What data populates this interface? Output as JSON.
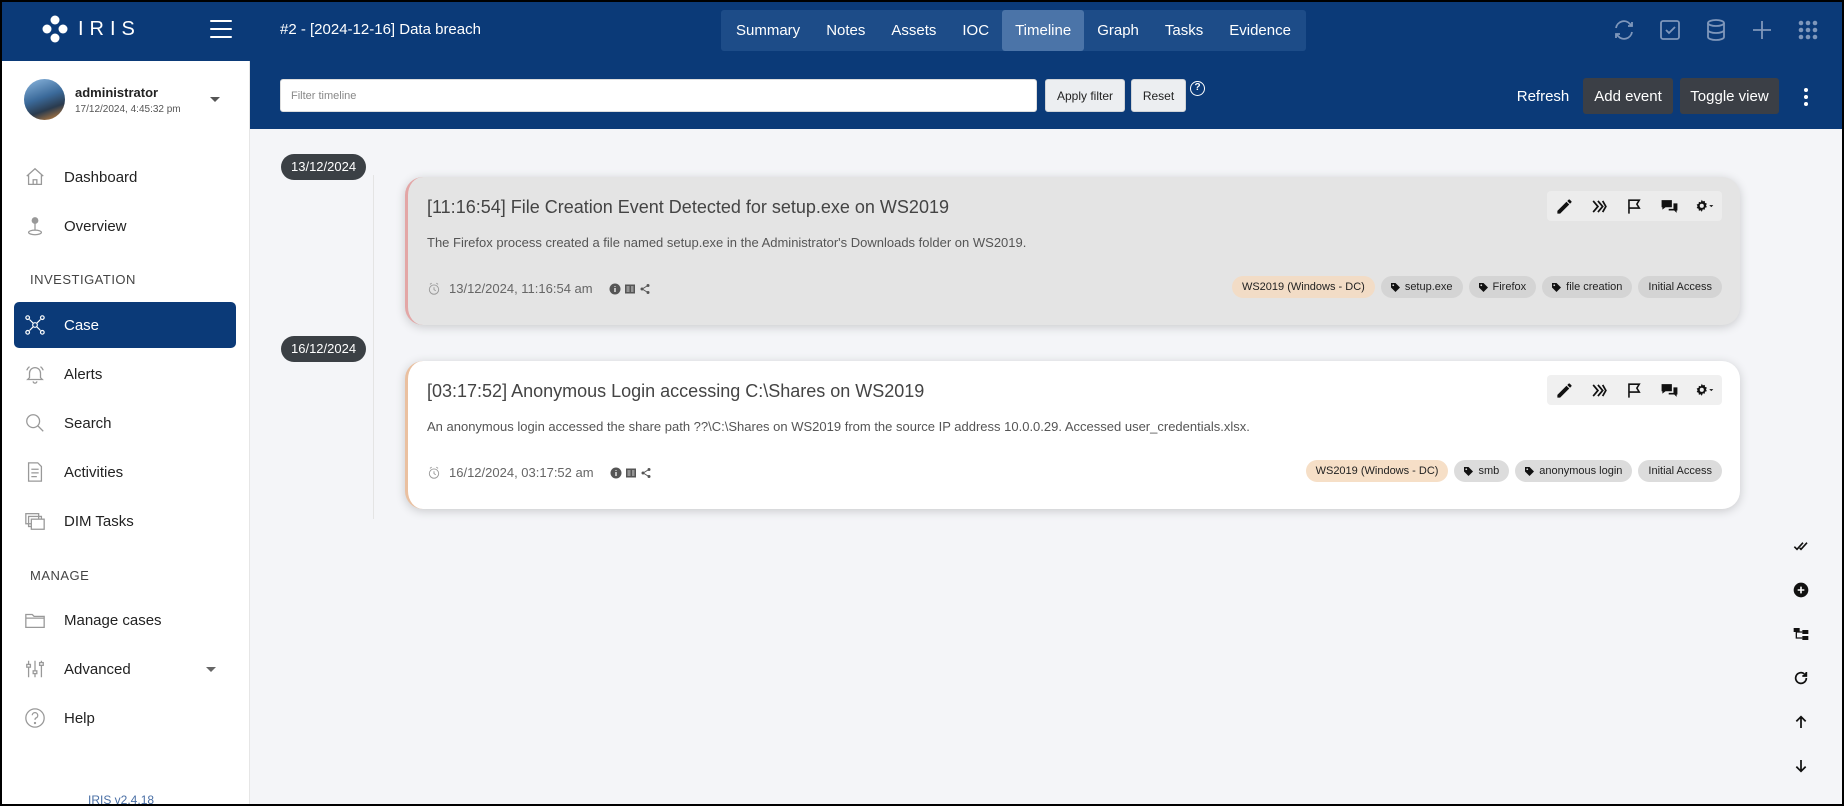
{
  "app": {
    "logo_text": "IRIS",
    "version": "IRIS v2.4.18"
  },
  "header": {
    "case_title": "#2 - [2024-12-16] Data breach",
    "tabs": [
      {
        "label": "Summary"
      },
      {
        "label": "Notes"
      },
      {
        "label": "Assets"
      },
      {
        "label": "IOC"
      },
      {
        "label": "Timeline",
        "active": true
      },
      {
        "label": "Graph"
      },
      {
        "label": "Tasks"
      },
      {
        "label": "Evidence"
      }
    ],
    "icons": [
      "refresh-icon",
      "check-square-icon",
      "database-icon",
      "plus-icon",
      "apps-grid-icon"
    ]
  },
  "filter": {
    "placeholder": "Filter timeline",
    "value": "",
    "apply_label": "Apply filter",
    "reset_label": "Reset",
    "help": "?",
    "refresh_label": "Refresh",
    "add_event_label": "Add event",
    "toggle_view_label": "Toggle view"
  },
  "user": {
    "name": "administrator",
    "datetime": "17/12/2024, 4:45:32 pm"
  },
  "sidebar": {
    "top_items": [
      {
        "label": "Dashboard",
        "icon": "home-icon"
      },
      {
        "label": "Overview",
        "icon": "pin-icon"
      }
    ],
    "investigation_label": "INVESTIGATION",
    "investigation_items": [
      {
        "label": "Case",
        "icon": "network-icon",
        "active": true
      },
      {
        "label": "Alerts",
        "icon": "bell-icon"
      },
      {
        "label": "Search",
        "icon": "search-icon"
      },
      {
        "label": "Activities",
        "icon": "file-list-icon"
      },
      {
        "label": "DIM Tasks",
        "icon": "windows-stack-icon"
      }
    ],
    "manage_label": "MANAGE",
    "manage_items": [
      {
        "label": "Manage cases",
        "icon": "folder-icon"
      },
      {
        "label": "Advanced",
        "icon": "sliders-icon"
      },
      {
        "label": "Help",
        "icon": "help-circle-icon"
      }
    ]
  },
  "timeline": {
    "groups": [
      {
        "date": "13/12/2024",
        "event": {
          "title": "[11:16:54] File Creation Event Detected for setup.exe on WS2019",
          "description": "The Firefox process created a file named setup.exe in the Administrator's Downloads folder on WS2019.",
          "datetime": "13/12/2024, 11:16:54 am",
          "asset_tag": "WS2019 (Windows - DC)",
          "tags": [
            "setup.exe",
            "Firefox",
            "file creation"
          ],
          "category": "Initial Access"
        }
      },
      {
        "date": "16/12/2024",
        "event": {
          "title": "[03:17:52] Anonymous Login accessing C:\\Shares on WS2019",
          "description": "An anonymous login accessed the share path ??\\C:\\Shares on WS2019 from the source IP address 10.0.0.29. Accessed user_credentials.xlsx.",
          "datetime": "16/12/2024, 03:17:52 am",
          "asset_tag": "WS2019 (Windows - DC)",
          "tags": [
            "smb",
            "anonymous login"
          ],
          "category": "Initial Access"
        }
      }
    ]
  },
  "colors": {
    "primary": "#0b3a78",
    "active_tab": "#4b74a8",
    "dark_button": "#3b3f46",
    "asset_tag": "#f6dfc7"
  }
}
